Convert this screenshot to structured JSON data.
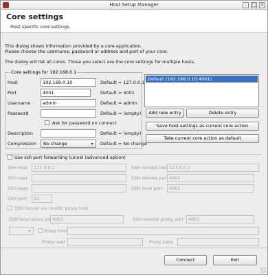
{
  "window": {
    "title": "Host Setup Manager"
  },
  "header": {
    "title": "Core settings",
    "subtitle": "Host specific core settings."
  },
  "info": {
    "line1": "This dialog shows information provided by a core application.",
    "line2": "Please choose the username, password or address and port of your core.",
    "line3": "The dialog will list all cores. Those you select are the core settings for multiple hosts."
  },
  "core_settings": {
    "group_label": "Core settings for 192.168.0.1",
    "host_label": "Host",
    "host_value": "192.168.0.10",
    "host_default": "Default = 127.0.0.1",
    "port_label": "Port",
    "port_value": "4001",
    "port_default": "Default = 4001",
    "username_label": "Username",
    "username_value": "admin",
    "username_default": "Default = admin",
    "password_label": "Password",
    "password_value": "",
    "password_default": "Default = (empty)",
    "ask_label": "Ask for password on connect",
    "description_label": "Description",
    "description_value": "",
    "description_default": "Default = (empty)",
    "compression_label": "Compression",
    "compression_value": "No change",
    "compression_default": "Default = No change"
  },
  "cores_list": {
    "selected_item": "Default (192.168.0.10:4001)"
  },
  "buttons": {
    "add_new_entry": "Add new entry",
    "delete_entry": "Delete entry",
    "save_host_settings": "Save host settings as current core action",
    "take_current_core": "Take current core action as default"
  },
  "ssh": {
    "enable_label": "Use ssh port forwarding tunnel (advanced option)",
    "ssh_host_label": "SSH host",
    "ssh_host_value": "127.0.0.1",
    "ssh_remote_host_label": "SSH remote host",
    "ssh_remote_host_value": "127.0.0.1",
    "ssh_user_label": "SSH user",
    "ssh_user_value": "",
    "ssh_remote_port_label": "SSH remote port",
    "ssh_remote_port_value": "4001",
    "ssh_pass_label": "SSH pass",
    "ssh_pass_value": "",
    "ssh_local_port_label": "SSH local port",
    "ssh_local_port_value": "4001",
    "ssh_port_label": "SSH port",
    "ssh_port_value": "22",
    "remote_via_label": "SSH tunnel via (multi) proxy host",
    "proxy_local_port_label": "SSH local proxy port",
    "proxy_local_port_value": "4001",
    "proxy_remote_port_label": "SSH remote proxy port",
    "proxy_remote_port_value": "4001",
    "proxy_type_value": "",
    "proxy_host_label": "Proxy host",
    "proxy_user_label": "Proxy user",
    "proxy_pass_label": "Proxy pass"
  },
  "footer": {
    "connect_label": "Connect",
    "exit_label": "Exit"
  }
}
